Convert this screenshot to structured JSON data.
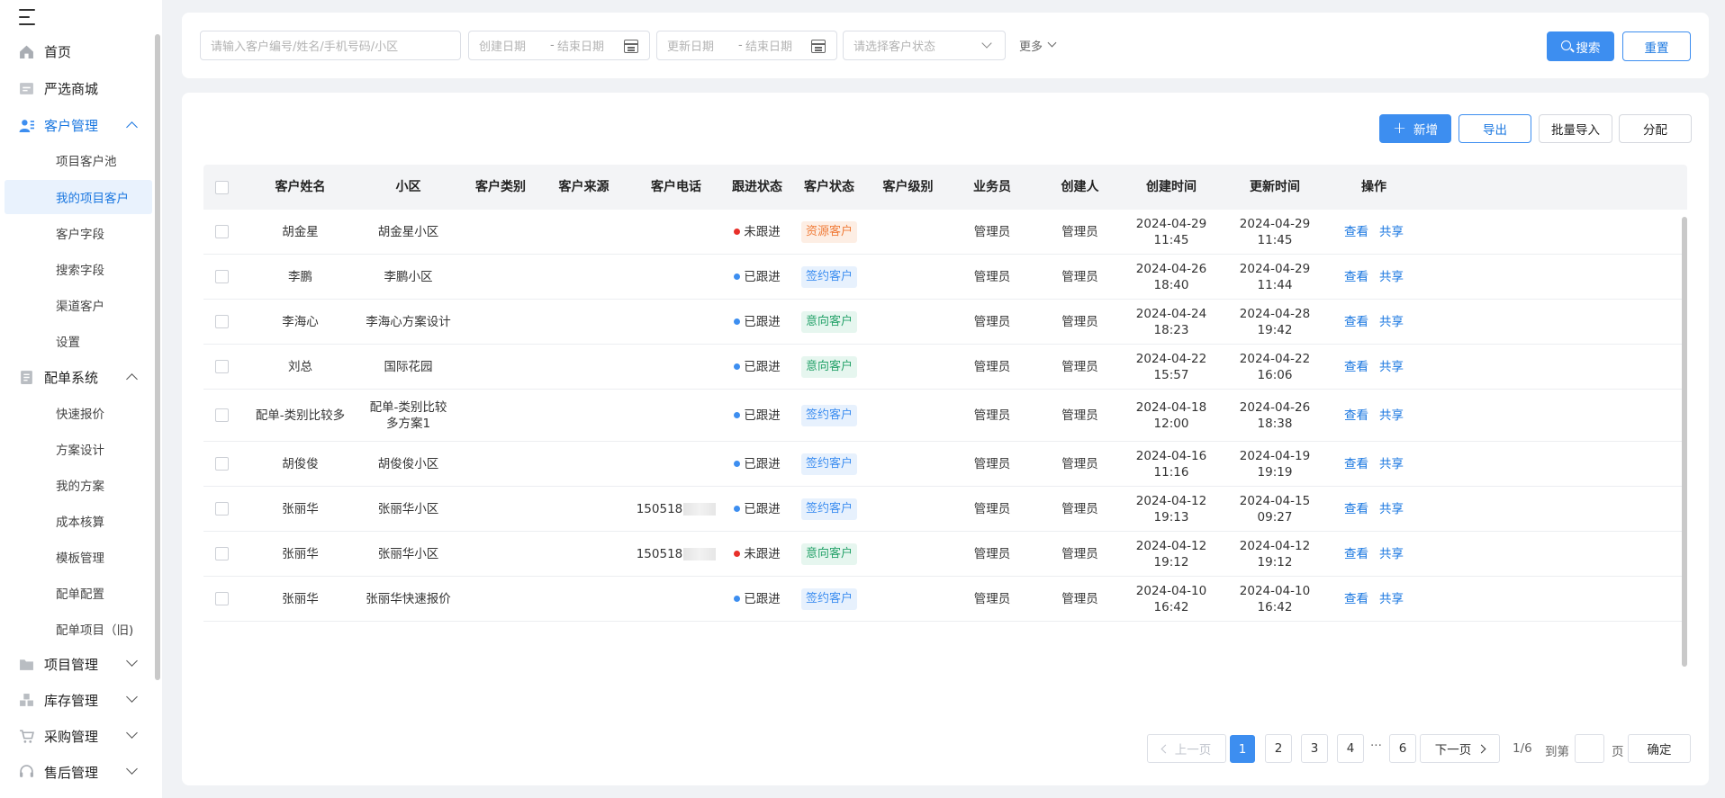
{
  "sidebar": {
    "items": [
      {
        "label": "首页"
      },
      {
        "label": "严选商城"
      },
      {
        "label": "客户管理"
      },
      {
        "label": "配单系统"
      },
      {
        "label": "项目管理"
      },
      {
        "label": "库存管理"
      },
      {
        "label": "采购管理"
      },
      {
        "label": "售后管理"
      }
    ],
    "customer_sub": [
      "项目客户池",
      "我的项目客户",
      "客户字段",
      "搜索字段",
      "渠道客户",
      "设置"
    ],
    "order_sub": [
      "快速报价",
      "方案设计",
      "我的方案",
      "成本核算",
      "模板管理",
      "配单配置",
      "配单项目（旧)"
    ]
  },
  "filters": {
    "keyword_placeholder": "请输入客户编号/姓名/手机号码/小区",
    "created_start": "创建日期",
    "created_end": "结束日期",
    "updated_start": "更新日期",
    "updated_end": "结束日期",
    "range_sep": "-",
    "status_placeholder": "请选择客户状态",
    "more": "更多",
    "search": "搜索",
    "reset": "重置"
  },
  "toolbar": {
    "add": "新增",
    "export": "导出",
    "batch_import": "批量导入",
    "assign": "分配"
  },
  "table": {
    "columns": [
      "客户姓名",
      "小区",
      "客户类别",
      "客户来源",
      "客户电话",
      "跟进状态",
      "客户状态",
      "客户级别",
      "业务员",
      "创建人",
      "创建时间",
      "更新时间",
      "操作"
    ],
    "action_view": "查看",
    "action_share": "共享",
    "rows": [
      {
        "name": "胡金星",
        "community": "胡金星小区",
        "category": "",
        "source": "",
        "phone": "",
        "follow": "未跟进",
        "status": "资源客户",
        "level": "",
        "salesman": "管理员",
        "creator": "管理员",
        "created": "2024-04-29 11:45",
        "updated": "2024-04-29 11:45"
      },
      {
        "name": "李鹏",
        "community": "李鹏小区",
        "category": "",
        "source": "",
        "phone": "",
        "follow": "已跟进",
        "status": "签约客户",
        "level": "",
        "salesman": "管理员",
        "creator": "管理员",
        "created": "2024-04-26 18:40",
        "updated": "2024-04-29 11:44"
      },
      {
        "name": "李海心",
        "community": "李海心方案设计",
        "category": "",
        "source": "",
        "phone": "",
        "follow": "已跟进",
        "status": "意向客户",
        "level": "",
        "salesman": "管理员",
        "creator": "管理员",
        "created": "2024-04-24 18:23",
        "updated": "2024-04-28 19:42"
      },
      {
        "name": "刘总",
        "community": "国际花园",
        "category": "",
        "source": "",
        "phone": "",
        "follow": "已跟进",
        "status": "意向客户",
        "level": "",
        "salesman": "管理员",
        "creator": "管理员",
        "created": "2024-04-22 15:57",
        "updated": "2024-04-22 16:06"
      },
      {
        "name": "配单-类别比较多",
        "community": "配单-类别比较多方案1",
        "category": "",
        "source": "",
        "phone": "",
        "follow": "已跟进",
        "status": "签约客户",
        "level": "",
        "salesman": "管理员",
        "creator": "管理员",
        "created": "2024-04-18 12:00",
        "updated": "2024-04-26 18:38"
      },
      {
        "name": "胡俊俊",
        "community": "胡俊俊小区",
        "category": "",
        "source": "",
        "phone": "",
        "follow": "已跟进",
        "status": "签约客户",
        "level": "",
        "salesman": "管理员",
        "creator": "管理员",
        "created": "2024-04-16 11:16",
        "updated": "2024-04-19 19:19"
      },
      {
        "name": "张丽华",
        "community": "张丽华小区",
        "category": "",
        "source": "",
        "phone": "150518",
        "follow": "已跟进",
        "status": "签约客户",
        "level": "",
        "salesman": "管理员",
        "creator": "管理员",
        "created": "2024-04-12 19:13",
        "updated": "2024-04-15 09:27"
      },
      {
        "name": "张丽华",
        "community": "张丽华小区",
        "category": "",
        "source": "",
        "phone": "150518",
        "follow": "未跟进",
        "status": "意向客户",
        "level": "",
        "salesman": "管理员",
        "creator": "管理员",
        "created": "2024-04-12 19:12",
        "updated": "2024-04-12 19:12"
      },
      {
        "name": "张丽华",
        "community": "张丽华快速报价",
        "category": "",
        "source": "",
        "phone": "",
        "follow": "已跟进",
        "status": "签约客户",
        "level": "",
        "salesman": "管理员",
        "creator": "管理员",
        "created": "2024-04-10 16:42",
        "updated": "2024-04-10 16:42"
      }
    ]
  },
  "pagination": {
    "prev": "上一页",
    "next": "下一页",
    "pages": [
      "1",
      "2",
      "3",
      "4",
      "6"
    ],
    "ellipsis": "···",
    "summary": "1/6",
    "goto": "到第",
    "page_unit": "页",
    "confirm": "确定"
  },
  "colors": {
    "accent": "#3d8ef0",
    "follow_no": "#e8302a",
    "follow_yes": "#3d8ef0",
    "tag_resource_bg": "#fdeee4",
    "tag_resource_fg": "#f07c39",
    "tag_signed_bg": "#e7f1fd",
    "tag_signed_fg": "#3d8ef0",
    "tag_intent_bg": "#e6f6ef",
    "tag_intent_fg": "#27a36b"
  }
}
